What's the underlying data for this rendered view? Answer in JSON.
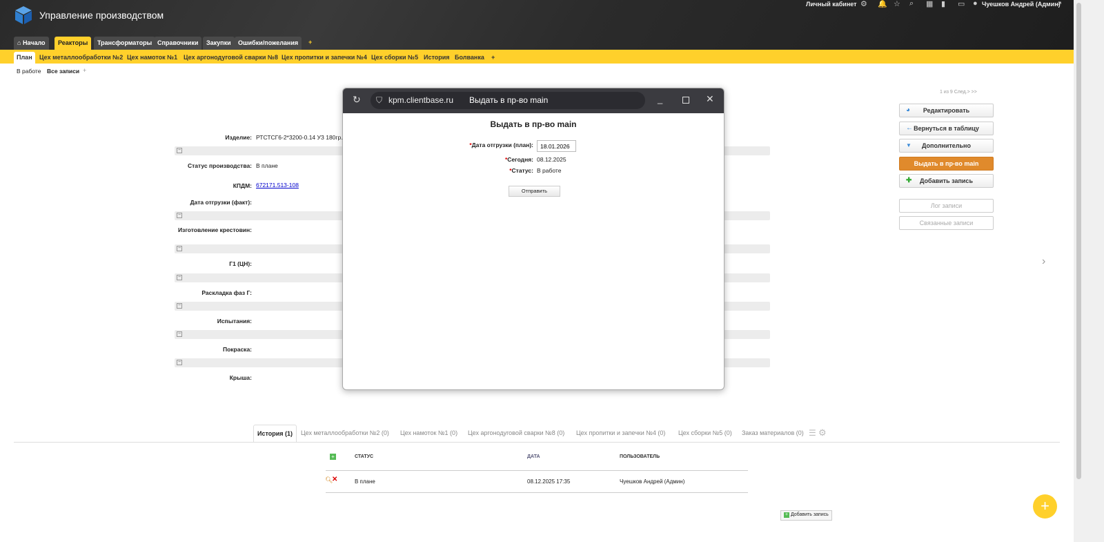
{
  "app": {
    "title": "Управление производством"
  },
  "topbar": {
    "cabinet": "Личный кабинет",
    "user": "Чуешков Андрей (Админ)"
  },
  "main_tabs": [
    "Начало",
    "Реакторы",
    "Трансформаторы",
    "Справочники",
    "Закупки",
    "Ошибки/пожелания"
  ],
  "sub_tabs": [
    "План",
    "Цех металлообработки №2",
    "Цех намоток №1",
    "Цех аргонодуговой сварки №8",
    "Цех пропитки и запечки №4",
    "Цех сборки №5",
    "История",
    "Болванка"
  ],
  "filters": [
    "В работе",
    "Все записи"
  ],
  "plus": "+",
  "pager": "1 из 9 След.> >>",
  "form": {
    "izdelie_label": "Изделие:",
    "izdelie": "РТСТСГ6-2*3200-0.14 УЗ 180гр.",
    "status_label": "Статус производства:",
    "status": "В плане",
    "kpdm_label": "КПДМ:",
    "kpdm": "672171.513-108",
    "ship_fact_label": "Дата отгрузки (факт):",
    "krest_label": "Изготовление крестовин:",
    "g1_label": "Г1 (ЦН):",
    "faz_label": "Раскладка фаз Г:",
    "test_label": "Испытания:",
    "paint_label": "Покраска:",
    "roof_label": "Крыша:"
  },
  "actions": {
    "edit": "Редактировать",
    "back": "Вернуться в таблицу",
    "more": "Дополнительно",
    "issue": "Выдать в пр-во main",
    "add": "Добавить запись",
    "log": "Лог записи",
    "linked": "Связанные записи"
  },
  "modal": {
    "url": "kpm.clientbase.ru",
    "window_title": "Выдать в пр-во main",
    "heading": "Выдать в пр-во main",
    "ship_plan_label": "Дата отгрузки (план):",
    "ship_plan": "18.01.2026",
    "today_label": "Сегодня:",
    "today": "08.12.2025",
    "status_label": "Статус:",
    "status": "В работе",
    "submit": "Отправить"
  },
  "bottom_tabs": [
    "История (1)",
    "Цех металлообработки №2 (0)",
    "Цех намоток №1 (0)",
    "Цех аргонодуговой сварки №8 (0)",
    "Цех пропитки и запечки №4 (0)",
    "Цех сборки №5 (0)",
    "Заказ материалов (0)"
  ],
  "history": {
    "headers": [
      "СТАТУС",
      "ДАТА",
      "ПОЛЬЗОВАТЕЛЬ"
    ],
    "rows": [
      {
        "status": "В плане",
        "date": "08.12.2025 17:35",
        "user": "Чуешков Андрей (Админ)"
      }
    ],
    "add": "Добавить запись"
  },
  "colors": {
    "accent": "#ffd02b",
    "orange": "#e08a2c",
    "header": "#2b2b2b"
  }
}
